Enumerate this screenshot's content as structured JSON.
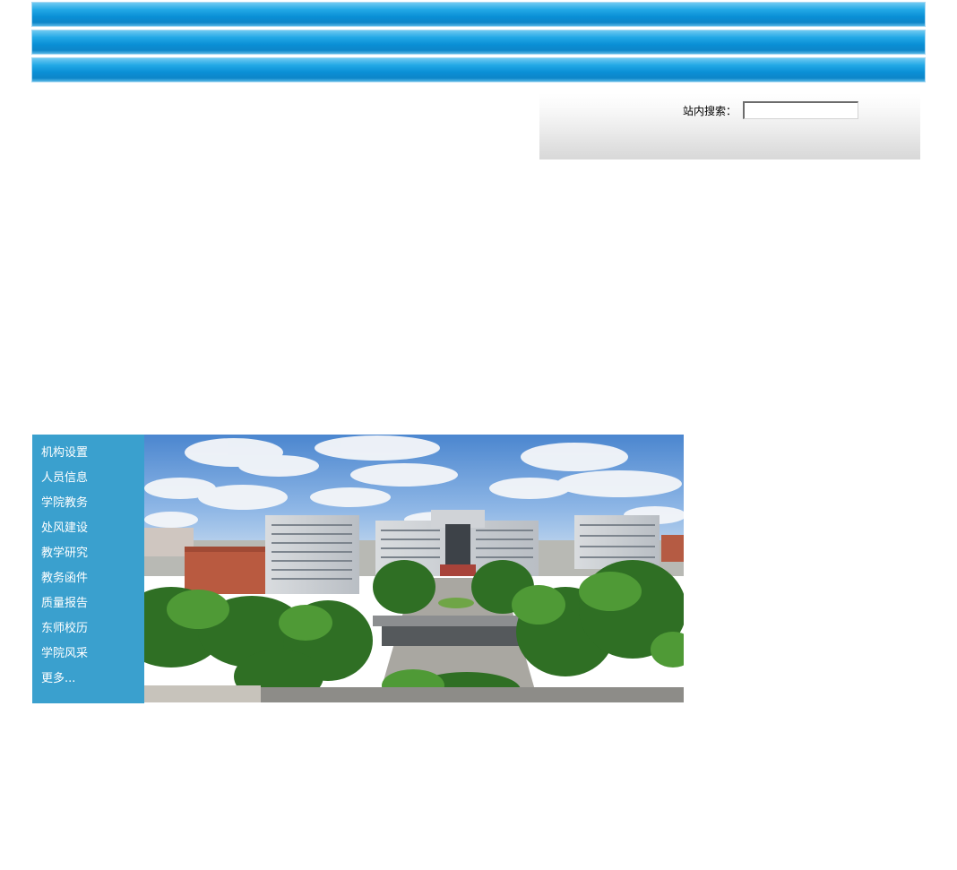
{
  "header": {
    "bars": [
      "",
      "",
      ""
    ]
  },
  "search": {
    "label": "站内搜索：",
    "value": "",
    "placeholder": ""
  },
  "nav": {
    "items": [
      {
        "label": "机构设置"
      },
      {
        "label": "人员信息"
      },
      {
        "label": "学院教务"
      },
      {
        "label": "处风建设"
      },
      {
        "label": "教学研究"
      },
      {
        "label": "教务函件"
      },
      {
        "label": "质量报告"
      },
      {
        "label": "东师校历"
      },
      {
        "label": "学院风采"
      },
      {
        "label": "更多..."
      }
    ]
  },
  "colors": {
    "header_bar": "#0a8fd6",
    "nav_background": "#3aa0ce",
    "nav_text": "#ffffff"
  }
}
